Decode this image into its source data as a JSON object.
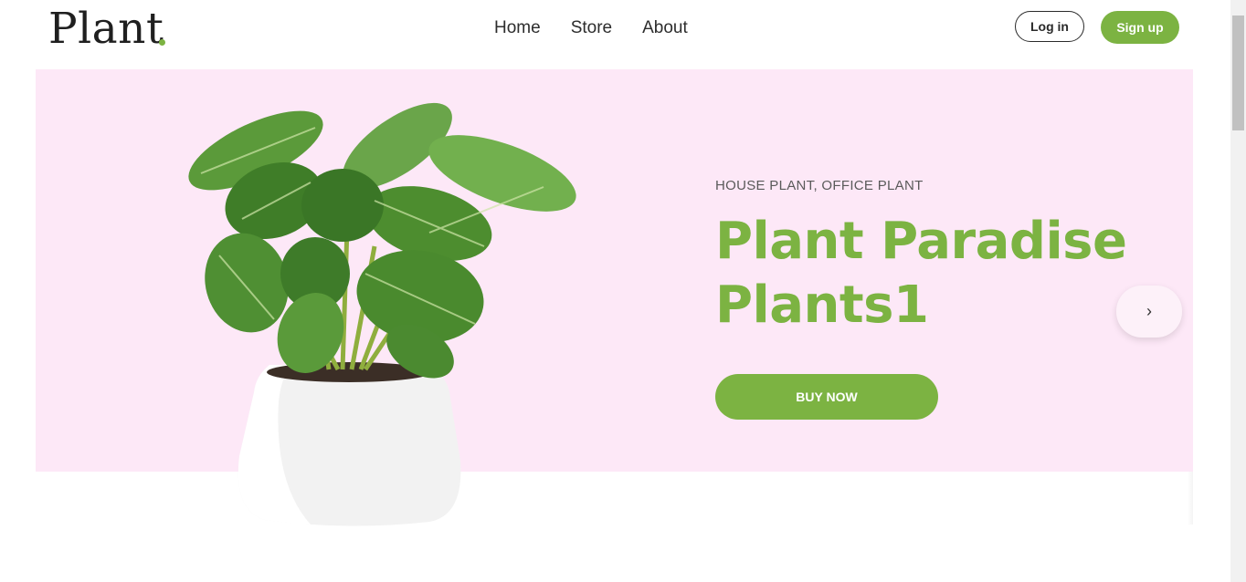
{
  "header": {
    "logo": "Plant",
    "nav": [
      "Home",
      "Store",
      "About"
    ],
    "login_label": "Log in",
    "signup_label": "Sign up"
  },
  "hero": {
    "subtitle": "HOUSE PLANT, OFFICE PLANT",
    "title": "Plant Paradise Plants1",
    "buy_label": "BUY NOW",
    "next_icon": "chevron-right-icon",
    "background_color": "#fde8f7",
    "accent_color": "#7cb342"
  }
}
